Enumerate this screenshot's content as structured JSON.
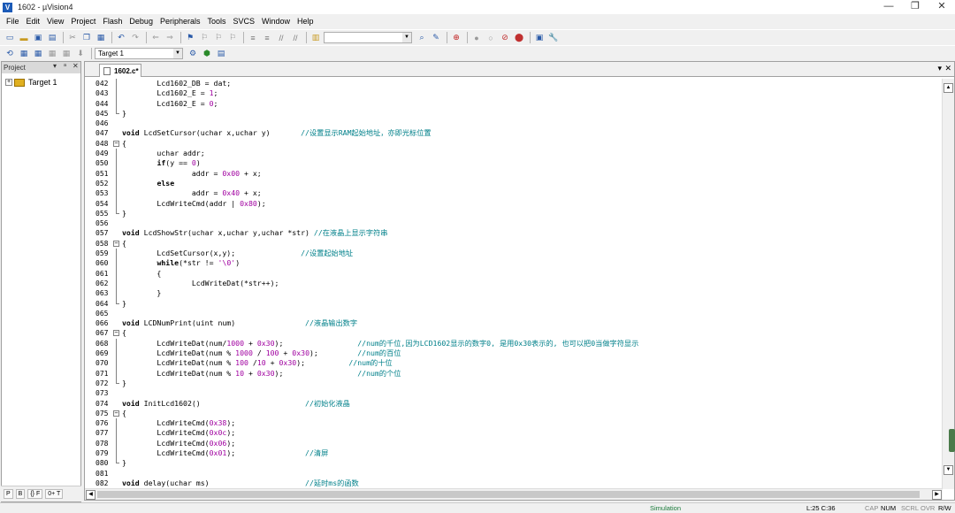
{
  "window": {
    "title": "1602  - µVision4",
    "app_icon": "uvision-icon"
  },
  "menu": [
    "File",
    "Edit",
    "View",
    "Project",
    "Flash",
    "Debug",
    "Peripherals",
    "Tools",
    "SVCS",
    "Window",
    "Help"
  ],
  "build_toolbar": {
    "target_combo": "Target 1"
  },
  "project_panel": {
    "title": "Project",
    "tree_root": "Target 1",
    "tabs": [
      "P",
      "B",
      "{} F",
      "0+ T"
    ]
  },
  "editor": {
    "active_tab": "1602.c*",
    "lines": [
      {
        "n": "042",
        "fold": "line",
        "t": [
          [
            "        Lcd1602_DB = dat;",
            ""
          ]
        ]
      },
      {
        "n": "043",
        "fold": "line",
        "t": [
          [
            "        Lcd1602_E = ",
            ""
          ],
          [
            "1",
            "num"
          ],
          [
            ";",
            ""
          ]
        ]
      },
      {
        "n": "044",
        "fold": "line",
        "t": [
          [
            "        Lcd1602_E = ",
            ""
          ],
          [
            "0",
            "num"
          ],
          [
            ";",
            ""
          ]
        ]
      },
      {
        "n": "045",
        "fold": "end",
        "t": [
          [
            "}",
            ""
          ]
        ]
      },
      {
        "n": "046",
        "fold": "",
        "t": []
      },
      {
        "n": "047",
        "fold": "",
        "t": [
          [
            "void",
            "kw"
          ],
          [
            " LcdSetCursor(uchar x,uchar y)       ",
            ""
          ],
          [
            "//设置显示RAM起始地址，亦即光标位置",
            "cmt"
          ]
        ]
      },
      {
        "n": "048",
        "fold": "open",
        "t": [
          [
            "{",
            ""
          ]
        ]
      },
      {
        "n": "049",
        "fold": "line",
        "t": [
          [
            "        uchar addr;",
            ""
          ]
        ]
      },
      {
        "n": "050",
        "fold": "line",
        "t": [
          [
            "        ",
            ""
          ],
          [
            "if",
            "kw"
          ],
          [
            "(y == ",
            ""
          ],
          [
            "0",
            "num"
          ],
          [
            ")",
            ""
          ]
        ]
      },
      {
        "n": "051",
        "fold": "line",
        "t": [
          [
            "                addr = ",
            ""
          ],
          [
            "0x00",
            "num"
          ],
          [
            " + x;",
            ""
          ]
        ]
      },
      {
        "n": "052",
        "fold": "line",
        "t": [
          [
            "        ",
            ""
          ],
          [
            "else",
            "kw"
          ]
        ]
      },
      {
        "n": "053",
        "fold": "line",
        "t": [
          [
            "                addr = ",
            ""
          ],
          [
            "0x40",
            "num"
          ],
          [
            " + x;",
            ""
          ]
        ]
      },
      {
        "n": "054",
        "fold": "line",
        "t": [
          [
            "        LcdWriteCmd(addr | ",
            ""
          ],
          [
            "0x80",
            "num"
          ],
          [
            ");",
            ""
          ]
        ]
      },
      {
        "n": "055",
        "fold": "end",
        "t": [
          [
            "}",
            ""
          ]
        ]
      },
      {
        "n": "056",
        "fold": "",
        "t": []
      },
      {
        "n": "057",
        "fold": "",
        "t": [
          [
            "void",
            "kw"
          ],
          [
            " LcdShowStr(uchar x,uchar y,uchar *str) ",
            ""
          ],
          [
            "//在液晶上显示字符串",
            "cmt"
          ]
        ]
      },
      {
        "n": "058",
        "fold": "open",
        "t": [
          [
            "{",
            ""
          ]
        ]
      },
      {
        "n": "059",
        "fold": "line",
        "t": [
          [
            "        LcdSetCursor(x,y);               ",
            ""
          ],
          [
            "//设置起始地址",
            "cmt"
          ]
        ]
      },
      {
        "n": "060",
        "fold": "line",
        "t": [
          [
            "        ",
            ""
          ],
          [
            "while",
            "kw"
          ],
          [
            "(*str != ",
            ""
          ],
          [
            "'\\0'",
            "str"
          ],
          [
            ")",
            ""
          ]
        ]
      },
      {
        "n": "061",
        "fold": "line",
        "t": [
          [
            "        {",
            ""
          ]
        ]
      },
      {
        "n": "062",
        "fold": "line",
        "t": [
          [
            "                LcdWriteDat(*str++);",
            ""
          ]
        ]
      },
      {
        "n": "063",
        "fold": "line",
        "t": [
          [
            "        }",
            ""
          ]
        ]
      },
      {
        "n": "064",
        "fold": "end",
        "t": [
          [
            "}",
            ""
          ]
        ]
      },
      {
        "n": "065",
        "fold": "",
        "t": []
      },
      {
        "n": "066",
        "fold": "",
        "t": [
          [
            "void",
            "kw"
          ],
          [
            " LCDNumPrint(uint num)                ",
            ""
          ],
          [
            "//液晶输出数字",
            "cmt"
          ]
        ]
      },
      {
        "n": "067",
        "fold": "open",
        "t": [
          [
            "{",
            ""
          ]
        ]
      },
      {
        "n": "068",
        "fold": "line",
        "t": [
          [
            "        LcdWriteDat(num/",
            ""
          ],
          [
            "1000",
            "num"
          ],
          [
            " + ",
            ""
          ],
          [
            "0x30",
            "num"
          ],
          [
            ");                 ",
            ""
          ],
          [
            "//num的千位,因为LCD1602显示的数字0, 是用0x30表示的, 也可以把0当做字符显示",
            "cmt"
          ]
        ]
      },
      {
        "n": "069",
        "fold": "line",
        "t": [
          [
            "        LcdWriteDat(num % ",
            ""
          ],
          [
            "1000",
            "num"
          ],
          [
            " / ",
            ""
          ],
          [
            "100",
            "num"
          ],
          [
            " + ",
            ""
          ],
          [
            "0x30",
            "num"
          ],
          [
            ");         ",
            ""
          ],
          [
            "//num的百位",
            "cmt"
          ]
        ]
      },
      {
        "n": "070",
        "fold": "line",
        "t": [
          [
            "        LcdWriteDat(num % ",
            ""
          ],
          [
            "100",
            "num"
          ],
          [
            " /",
            ""
          ],
          [
            "10",
            "num"
          ],
          [
            " + ",
            ""
          ],
          [
            "0x30",
            "num"
          ],
          [
            ");          ",
            ""
          ],
          [
            "//num的十位",
            "cmt"
          ]
        ]
      },
      {
        "n": "071",
        "fold": "line",
        "t": [
          [
            "        LcdWriteDat(num % ",
            ""
          ],
          [
            "10",
            "num"
          ],
          [
            " + ",
            ""
          ],
          [
            "0x30",
            "num"
          ],
          [
            ");                 ",
            ""
          ],
          [
            "//num的个位",
            "cmt"
          ]
        ]
      },
      {
        "n": "072",
        "fold": "end",
        "t": [
          [
            "}",
            ""
          ]
        ]
      },
      {
        "n": "073",
        "fold": "",
        "t": []
      },
      {
        "n": "074",
        "fold": "",
        "t": [
          [
            "void",
            "kw"
          ],
          [
            " InitLcd1602()                        ",
            ""
          ],
          [
            "//初始化液晶",
            "cmt"
          ]
        ]
      },
      {
        "n": "075",
        "fold": "open",
        "t": [
          [
            "{",
            ""
          ]
        ]
      },
      {
        "n": "076",
        "fold": "line",
        "t": [
          [
            "        LcdWriteCmd(",
            ""
          ],
          [
            "0x38",
            "num"
          ],
          [
            ");",
            ""
          ]
        ]
      },
      {
        "n": "077",
        "fold": "line",
        "t": [
          [
            "        LcdWriteCmd(",
            ""
          ],
          [
            "0x0c",
            "num"
          ],
          [
            ");",
            ""
          ]
        ]
      },
      {
        "n": "078",
        "fold": "line",
        "t": [
          [
            "        LcdWriteCmd(",
            ""
          ],
          [
            "0x06",
            "num"
          ],
          [
            ");",
            ""
          ]
        ]
      },
      {
        "n": "079",
        "fold": "line",
        "t": [
          [
            "        LcdWriteCmd(",
            ""
          ],
          [
            "0x01",
            "num"
          ],
          [
            ");                ",
            ""
          ],
          [
            "//清屏",
            "cmt"
          ]
        ]
      },
      {
        "n": "080",
        "fold": "end",
        "t": [
          [
            "}",
            ""
          ]
        ]
      },
      {
        "n": "081",
        "fold": "",
        "t": []
      },
      {
        "n": "082",
        "fold": "",
        "t": [
          [
            "void",
            "kw"
          ],
          [
            " delay(uchar ms)                      ",
            ""
          ],
          [
            "//延时ms的函数",
            "cmt"
          ]
        ]
      }
    ]
  },
  "status": {
    "mode": "Simulation",
    "position": "L:25 C:36",
    "cap": "CAP",
    "num": "NUM",
    "scrl": "SCRL",
    "ovr": "OVR",
    "rw": "R/W"
  },
  "colors": {
    "keyword": "#000000",
    "number": "#a000a0",
    "comment": "#00808a"
  }
}
